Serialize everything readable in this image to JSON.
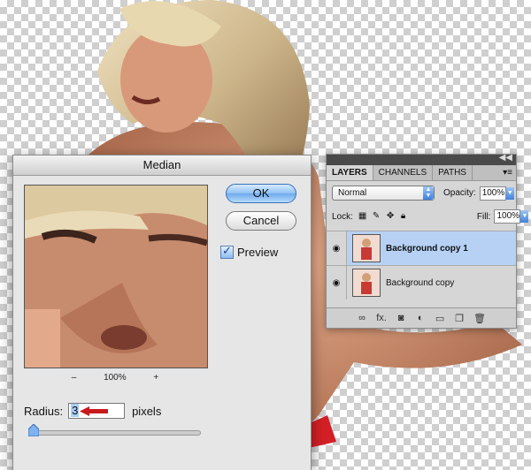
{
  "dialog": {
    "title": "Median",
    "ok_label": "OK",
    "cancel_label": "Cancel",
    "preview_label": "Preview",
    "preview_checked": true,
    "zoom_minus": "–",
    "zoom_level": "100%",
    "zoom_plus": "+",
    "radius_label": "Radius:",
    "radius_value": "3",
    "radius_unit": "pixels"
  },
  "layers_panel": {
    "tabs": [
      {
        "label": "LAYERS",
        "active": true
      },
      {
        "label": "CHANNELS",
        "active": false
      },
      {
        "label": "PATHS",
        "active": false
      }
    ],
    "blend_mode": "Normal",
    "opacity_label": "Opacity:",
    "opacity_value": "100%",
    "lock_label": "Lock:",
    "fill_label": "Fill:",
    "fill_value": "100%",
    "layers": [
      {
        "name": "Background copy 1",
        "selected": true
      },
      {
        "name": "Background copy",
        "selected": false
      }
    ],
    "footer_icons": [
      "link-icon",
      "fx-icon",
      "mask-icon",
      "adjustment-icon",
      "folder-icon",
      "new-layer-icon",
      "trash-icon"
    ],
    "footer_fx_label": "fx."
  },
  "colors": {
    "ok_button": "#6ea9ec",
    "selected_layer": "#b6d1f4",
    "arrow": "#c8191c"
  }
}
